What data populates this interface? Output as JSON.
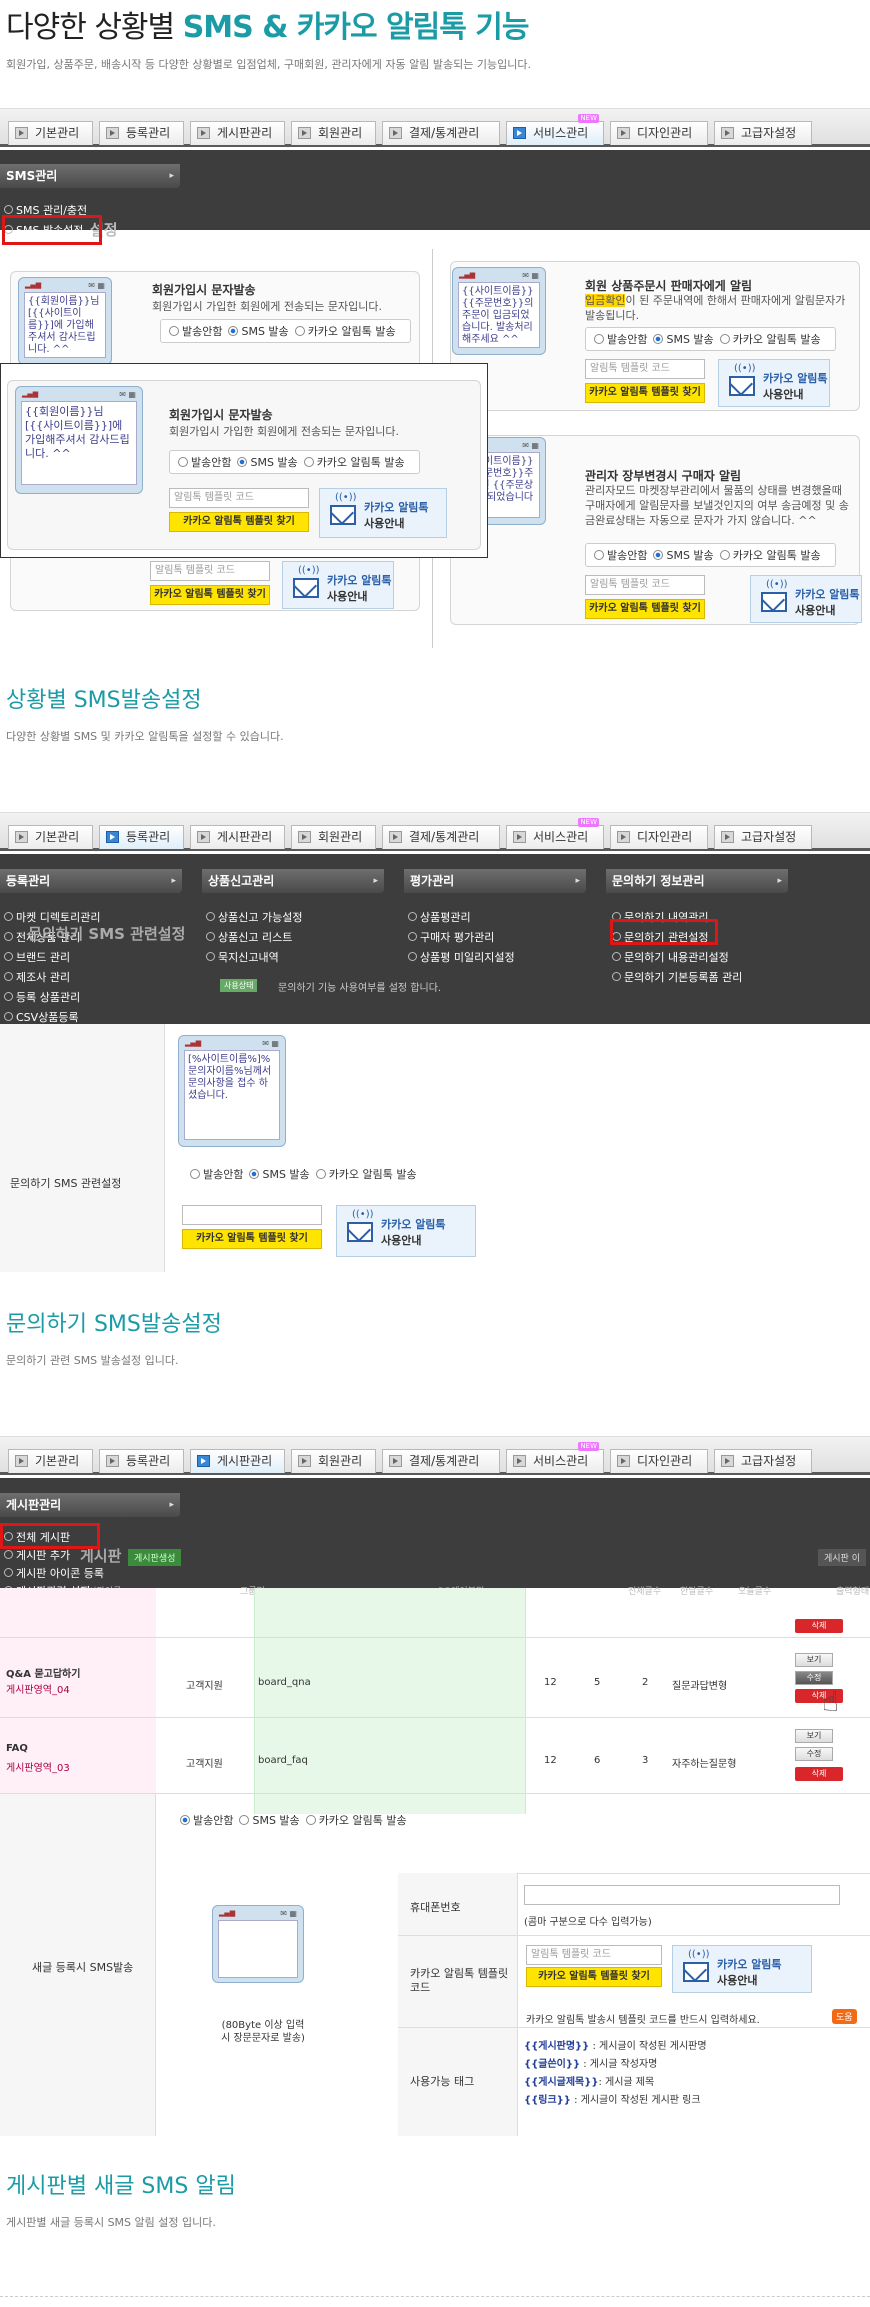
{
  "header": {
    "title_plain": "다양한 상황별 ",
    "title_bold": "SMS & 카카오 알림톡 기능",
    "subtitle": "회원가입, 상품주문, 배송시작 등 다양한 상황별로 입점업체, 구매회원, 관리자에게 자동 알림 발송되는 기능입니다."
  },
  "tabs": [
    "기본관리",
    "등록관리",
    "게시판관리",
    "회원관리",
    "결제/통계관리",
    "서비스관리",
    "디자인관리",
    "고급자설정"
  ],
  "new_tag": "NEW",
  "section1": {
    "menu_head": "SMS관리",
    "menu_items": [
      "SMS 관리/충전",
      "SMS 발송설정"
    ],
    "blur_title": "설정",
    "panels": {
      "signup_title": "회원가입시 문자발송",
      "signup_desc": "회원가입시 가입한 회원에게 전송되는 문자입니다.",
      "order_title": "회원 상품주문시 판매자에게 알림",
      "order_desc_highlight": "입금확인",
      "order_desc": "이 된 주문내역에 한해서 판매자에게 알림문자가 발송됩니다.",
      "order_phone": "{{사이트이름}}{{주문번호}}의 주문이 입금되었습니다. 발송처리해주세요 ^^",
      "status_title": "관리자 장부변경시 구매자 알림",
      "status_desc": "관리자모드 마켓장부관리에서 물품의 상태를 변경했을때 구매자에게 알림문자를 보낼것인지의 여부 송금예정 및 송금완료상태는 자동으로 문자가 가지 않습니다. ^^",
      "status_phone": "{{사이트이름}}{{주문번호}}주문하신 {{주문상태}} 되었습니다",
      "signup_phone": "{{회원이름}}님 [{{사이트이름}}]에 가입해주셔서 감사드립니다. ^^"
    },
    "radio": [
      "발송안함",
      "SMS 발송",
      "카카오 알림톡 발송"
    ],
    "template_placeholder": "알림톡 템플릿 코드",
    "template_button": "카카오 알림톡 템플릿 찾기",
    "kakao_line1": "카카오 알림톡",
    "kakao_line2": "사용안내",
    "caption": "상황별 SMS발송설정",
    "caption_sub": "다양한 상황별 SMS 및 카카오 알림톡을 설정할 수 있습니다."
  },
  "section2": {
    "menu_heads": [
      "등록관리",
      "상품신고관리",
      "평가관리",
      "문의하기 정보관리"
    ],
    "col1": [
      "마켓 디렉토리관리",
      "전체상품 관리",
      "브랜드 관리",
      "제조사 관리",
      "등록 상품관리",
      "CSV상품등록"
    ],
    "col2": [
      "상품신고 가능설정",
      "상품신고 리스트",
      "묵지신고내역"
    ],
    "col3": [
      "상품평관리",
      "구매자 평가관리",
      "상품평 미일리지설정"
    ],
    "col4": [
      "문의하기 내역관리",
      "문의하기 관련설정",
      "문의하기 내용관리설정",
      "문의하기 기본등록폼 관리"
    ],
    "blur_title": "문의하기 SMS 관련설정",
    "usage_badge": "사용상태",
    "usage_text": "문의하기 기능 사용여부를 설정 합니다.",
    "row_label": "문의하기 SMS 관련설정",
    "phone_text": "[%사이트이름%]%문의자이름%님께서 문의사항을 접수 하셨습니다.",
    "caption": "문의하기 SMS발송설정",
    "caption_sub": "문의하기 관련 SMS 발송설정 입니다."
  },
  "section3": {
    "menu_head": "게시판관리",
    "menu_items": [
      "전체 게시판",
      "게시판 추가",
      "게시판 아이콘 등록",
      "게시판관련 설정"
    ],
    "blur_title": "게시판",
    "green_button": "게시판생성",
    "right_button": "게시판 이",
    "col_headers": [
      "게시판이름",
      "그룹명",
      "DB테이블명",
      "전체글수",
      "한달글수",
      "오늘글수",
      "출력형태"
    ],
    "rows": [
      {
        "name": "Q&A 묻고답하기",
        "area": "게시판영역_04",
        "group": "고객지원",
        "table": "board_qna",
        "total": "12",
        "month": "5",
        "today": "2",
        "type": "질문과답변형"
      },
      {
        "name": "FAQ",
        "area": "게시판영역_03",
        "group": "고객지원",
        "table": "board_faq",
        "total": "12",
        "month": "6",
        "today": "3",
        "type": "자주하는질문형"
      }
    ],
    "btn_view": "보기",
    "btn_edit": "수정",
    "btn_delete": "삭제",
    "row_label": "새글 등록시 SMS발송",
    "phone_note": "(80Byte 이상 입력시 장문문자로 발송)",
    "mobile_label": "휴대폰번호",
    "mobile_note": "(콤마 구분으로 다수 입력가능)",
    "template_label": "카카오 알림톡 템플릿코드",
    "template_note": "카카오 알림톡 발송시 템플릿 코드를 반드시 입력하세요.",
    "help_badge": "도움",
    "tags_label": "사용가능 태그",
    "tags": [
      {
        "tag": "{{게시판명}}",
        "desc": " : 게시글이 작성된 게시판명"
      },
      {
        "tag": "{{글쓴이}}",
        "desc": " : 게시글 작성자명"
      },
      {
        "tag": "{{게시글제목}}",
        "desc": ": 게시글 제목"
      },
      {
        "tag": "{{링크}}",
        "desc": " : 게시글이 작성된 게시판 링크"
      }
    ],
    "caption": "게시판별 새글 SMS 알림",
    "caption_sub": "게시판별 새글 등록시 SMS 알림 설정 입니다."
  }
}
